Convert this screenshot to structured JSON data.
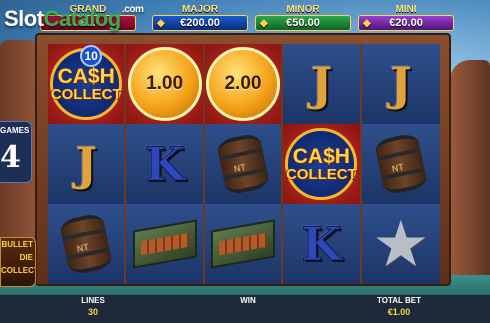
{
  "watermark": {
    "part1": "Slot",
    "part2": "Catalog",
    "suffix": ".com"
  },
  "jackpots": [
    {
      "name": "GRAND",
      "value": "€..."
    },
    {
      "name": "MAJOR",
      "value": "€200.00"
    },
    {
      "name": "MINOR",
      "value": "€50.00"
    },
    {
      "name": "MINI",
      "value": "€20.00"
    }
  ],
  "free_games": {
    "label": "GAMES",
    "count": "4"
  },
  "side_logo": {
    "line1": "BULLET",
    "line2": "DIE",
    "line3": "COLLECT"
  },
  "reels": {
    "cash_collect": {
      "line1": "CA$H",
      "line2": "COLLECT",
      "multiplier": "10"
    },
    "coin_values": [
      "1.00",
      "2.00"
    ],
    "letters": {
      "j": "J",
      "k": "K"
    },
    "barrel_label": "NT"
  },
  "bottom_bar": {
    "lines_label": "LINES",
    "lines_value": "30",
    "win_label": "WIN",
    "win_value": "",
    "bet_label": "TOTAL BET",
    "bet_value": "€1.00"
  }
}
